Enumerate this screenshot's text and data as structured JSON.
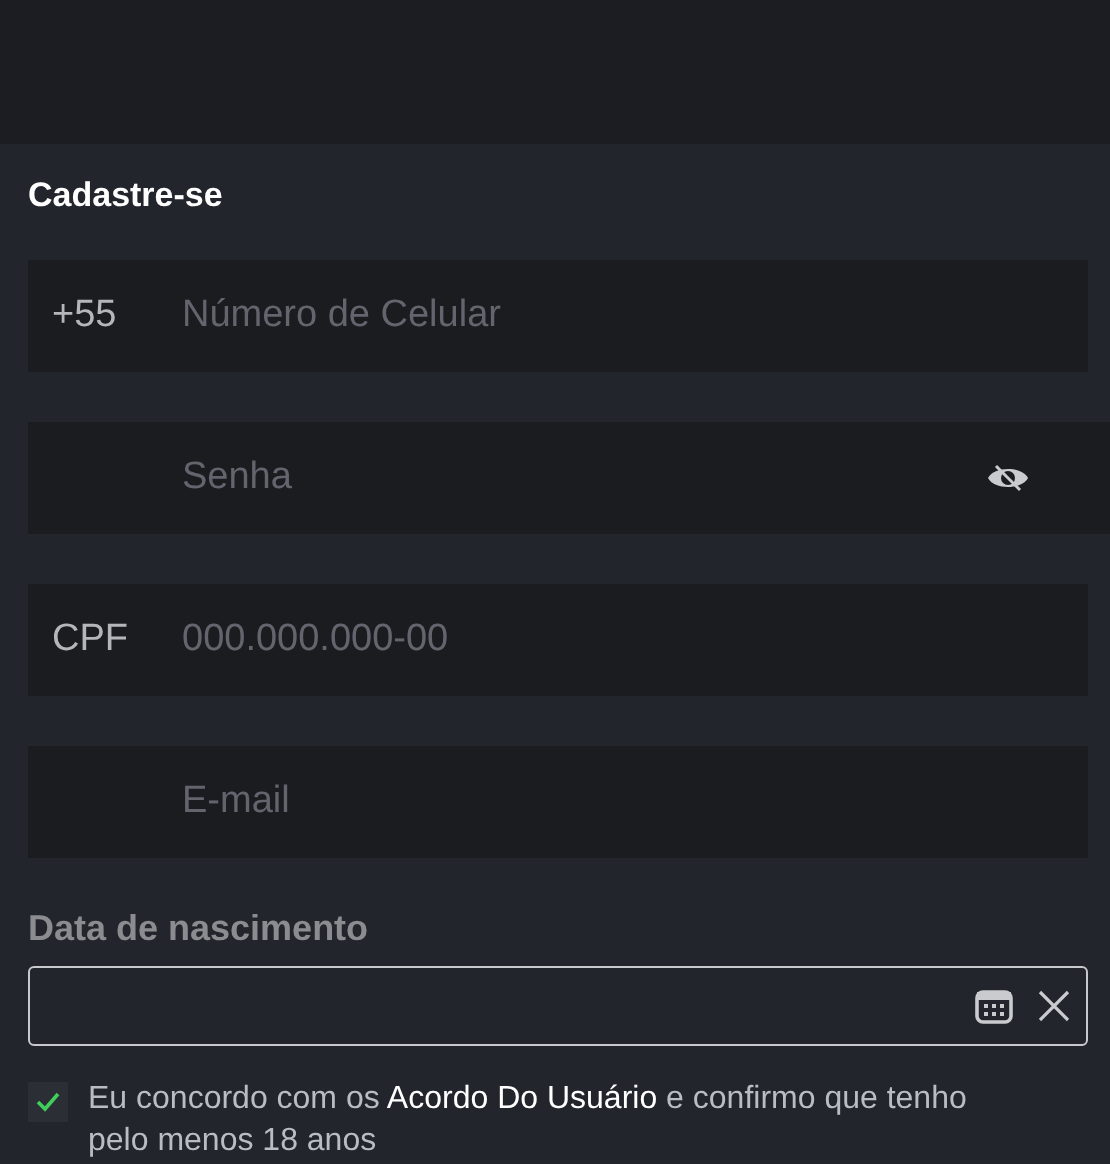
{
  "title": "Cadastre-se",
  "fields": [
    {
      "kind": "phone",
      "prefix": "+55",
      "placeholder": "Número de Celular"
    },
    {
      "kind": "password",
      "placeholder": "Senha"
    },
    {
      "kind": "cpf",
      "prefix": "CPF",
      "placeholder": "000.000.000-00"
    },
    {
      "kind": "email",
      "placeholder": "E-mail"
    }
  ],
  "birth_date": {
    "label": "Data de nascimento"
  },
  "agreement": {
    "checked": true,
    "text_before": "Eu concordo com os",
    "link": "Acordo Do Usuário",
    "text_after": "e confirmo que tenho pelo menos 18 anos"
  }
}
